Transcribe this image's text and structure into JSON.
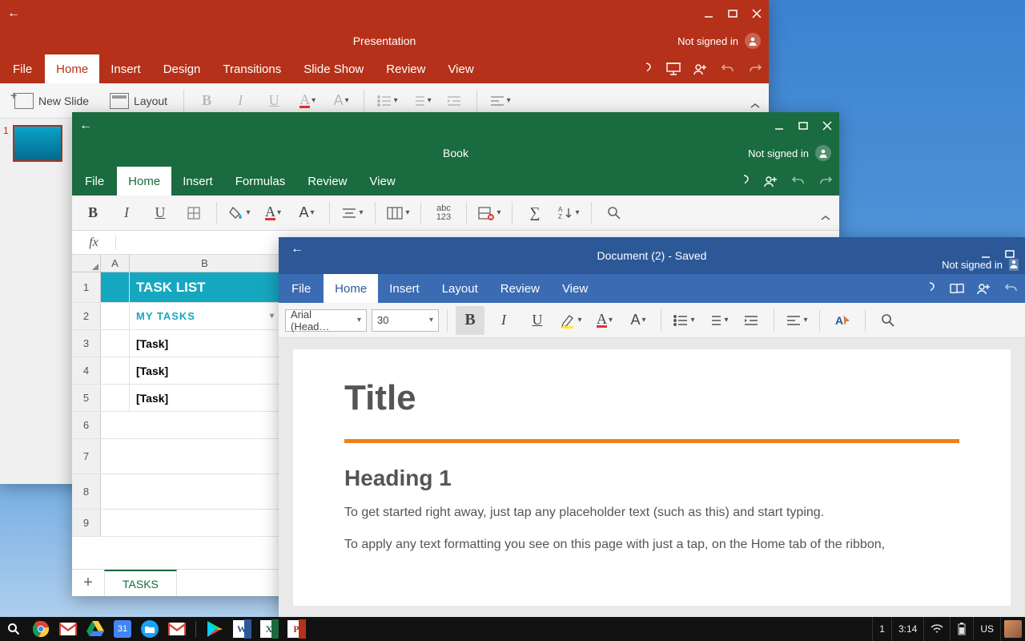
{
  "powerpoint": {
    "title": "Presentation",
    "signin": "Not signed in",
    "tabs": [
      "File",
      "Home",
      "Insert",
      "Design",
      "Transitions",
      "Slide Show",
      "Review",
      "View"
    ],
    "active_tab": 1,
    "newslide": "New Slide",
    "layout": "Layout",
    "thumb_num": "1"
  },
  "excel": {
    "title": "Book",
    "signin": "Not signed in",
    "tabs": [
      "File",
      "Home",
      "Insert",
      "Formulas",
      "Review",
      "View"
    ],
    "active_tab": 1,
    "abc": "abc",
    "n123": "123",
    "cols": [
      "A",
      "B"
    ],
    "rows": [
      "1",
      "2",
      "3",
      "4",
      "5",
      "6",
      "7",
      "8",
      "9"
    ],
    "tasklist": "TASK LIST",
    "mytasks": "MY  TASKS",
    "tasks": [
      "[Task]",
      "[Task]",
      "[Task]"
    ],
    "sheet": "TASKS"
  },
  "word": {
    "title": "Document (2)  -  Saved",
    "signin": "Not signed in",
    "tabs": [
      "File",
      "Home",
      "Insert",
      "Layout",
      "Review",
      "View"
    ],
    "active_tab": 1,
    "font": "Arial (Head…",
    "size": "30",
    "doc_title": "Title",
    "doc_h1": "Heading 1",
    "doc_p1": "To get started right away, just tap any placeholder text (such as this) and start typing.",
    "doc_p2": "To apply any text formatting you see on this page with just a tap, on the Home tab of the ribbon,"
  },
  "taskbar": {
    "workspace": "1",
    "time": "3:14",
    "lang": "US"
  }
}
